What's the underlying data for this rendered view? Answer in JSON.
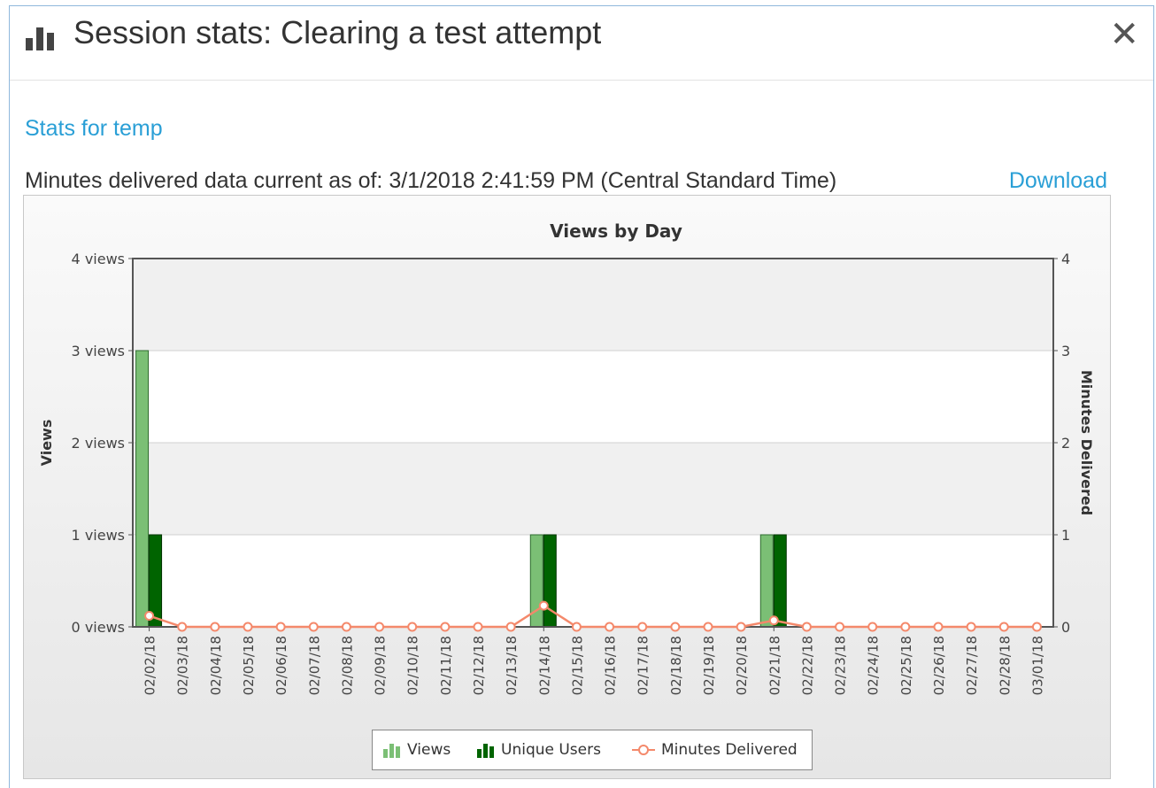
{
  "dialog": {
    "title": "Session stats: Clearing a test attempt",
    "close_glyph": "✕",
    "header_icon": "bar-chart-icon"
  },
  "stats_link": "Stats for temp",
  "asof_text": "Minutes delivered data current as of: 3/1/2018 2:41:59 PM (Central Standard Time)",
  "download_label": "Download",
  "colors": {
    "views": "#7bbf75",
    "unique_users": "#006400",
    "minutes": "#f4896b",
    "link": "#2a9fd6"
  },
  "chart_data": {
    "type": "bar",
    "title": "Views by Day",
    "ylabel": "Views",
    "y2label": "Minutes Delivered",
    "ylim": [
      0,
      4
    ],
    "y2lim": [
      0,
      4
    ],
    "y_ticks": [
      "0 views",
      "1 views",
      "2 views",
      "3 views",
      "4 views"
    ],
    "y2_ticks": [
      "0",
      "1",
      "2",
      "3",
      "4"
    ],
    "categories": [
      "02/02/18",
      "02/03/18",
      "02/04/18",
      "02/05/18",
      "02/06/18",
      "02/07/18",
      "02/08/18",
      "02/09/18",
      "02/10/18",
      "02/11/18",
      "02/12/18",
      "02/13/18",
      "02/14/18",
      "02/15/18",
      "02/16/18",
      "02/17/18",
      "02/18/18",
      "02/19/18",
      "02/20/18",
      "02/21/18",
      "02/22/18",
      "02/23/18",
      "02/24/18",
      "02/25/18",
      "02/26/18",
      "02/27/18",
      "02/28/18",
      "03/01/18"
    ],
    "series": [
      {
        "name": "Views",
        "kind": "bar",
        "values": [
          3,
          0,
          0,
          0,
          0,
          0,
          0,
          0,
          0,
          0,
          0,
          0,
          1,
          0,
          0,
          0,
          0,
          0,
          0,
          1,
          0,
          0,
          0,
          0,
          0,
          0,
          0,
          0
        ]
      },
      {
        "name": "Unique Users",
        "kind": "bar",
        "values": [
          1,
          0,
          0,
          0,
          0,
          0,
          0,
          0,
          0,
          0,
          0,
          0,
          1,
          0,
          0,
          0,
          0,
          0,
          0,
          1,
          0,
          0,
          0,
          0,
          0,
          0,
          0,
          0
        ]
      },
      {
        "name": "Minutes Delivered",
        "kind": "line",
        "axis": "right",
        "values": [
          0.12,
          0,
          0,
          0,
          0,
          0,
          0,
          0,
          0,
          0,
          0,
          0,
          0.23,
          0,
          0,
          0,
          0,
          0,
          0,
          0.07,
          0,
          0,
          0,
          0,
          0,
          0,
          0,
          0
        ]
      }
    ],
    "grid": true,
    "legend_position": "bottom"
  }
}
